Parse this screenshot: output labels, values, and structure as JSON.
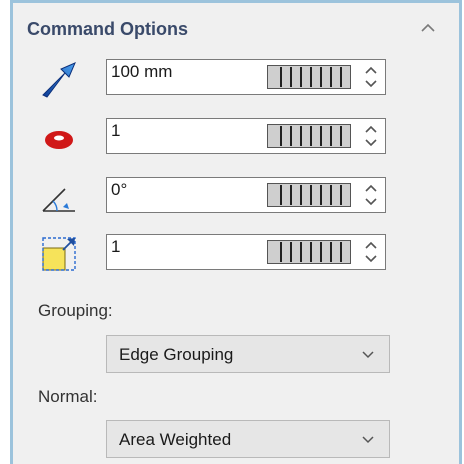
{
  "panel": {
    "title": "Command Options"
  },
  "rows": [
    {
      "value": "100 mm",
      "icon": "arrow-icon"
    },
    {
      "value": "1",
      "icon": "torus-icon"
    },
    {
      "value": "0°",
      "icon": "angle-icon"
    },
    {
      "value": "1",
      "icon": "scale-icon"
    }
  ],
  "grouping": {
    "label": "Grouping:",
    "selected": "Edge Grouping"
  },
  "normal": {
    "label": "Normal:",
    "selected": "Area Weighted"
  },
  "colors": {
    "panel_bg": "#f0f0f0",
    "border": "#9cc3dc",
    "title": "#3a4a6a",
    "arrow_blue": "#1f63c8",
    "torus_red": "#d01818",
    "scale_yellow": "#f6e35a"
  }
}
